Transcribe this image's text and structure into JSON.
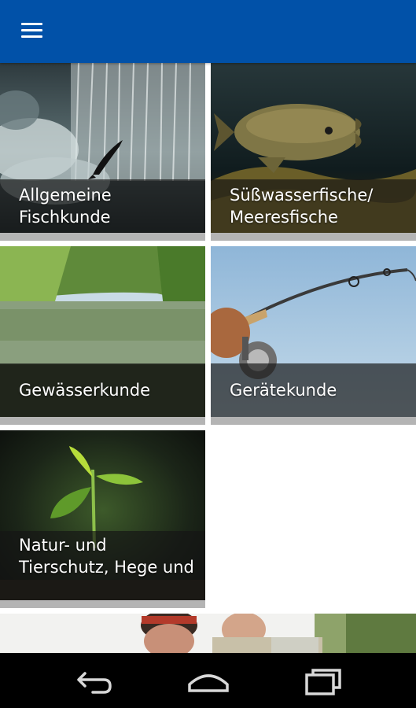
{
  "app_bar": {
    "menu_icon": "hamburger-menu-icon",
    "background_color": "#0151a8"
  },
  "categories": [
    {
      "label": "Allgemeine Fischkunde",
      "image": "waterfall-salmon-photo"
    },
    {
      "label": "Süßwasserfische/ Meeresfische",
      "image": "carp-underwater-photo"
    },
    {
      "label": "Gewässerkunde",
      "image": "lake-forest-photo"
    },
    {
      "label": "Gerätekunde",
      "image": "fishing-rod-reel-photo"
    },
    {
      "label": "Natur- und Tierschutz, Hege und",
      "image": "sprout-seedling-photo"
    },
    {
      "label": "",
      "image": "anglers-people-photo"
    }
  ],
  "nav_bar": {
    "back_icon": "back-arrow-icon",
    "home_icon": "home-icon",
    "recents_icon": "recent-apps-icon"
  }
}
